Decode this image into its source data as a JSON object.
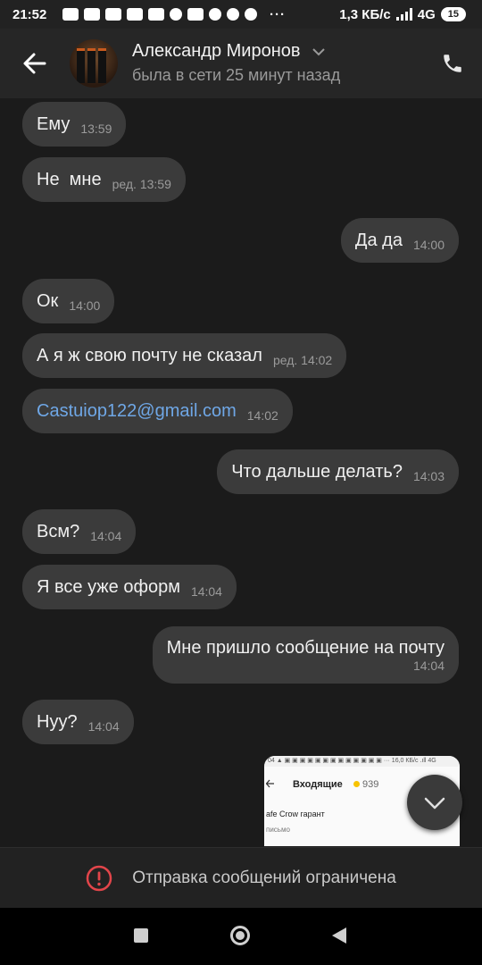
{
  "status_bar": {
    "time": "21:52",
    "dots": "···",
    "network_speed": "1,3 КБ/с",
    "network_type": "4G",
    "battery": "15"
  },
  "header": {
    "contact_name": "Александр Миронов",
    "last_seen": "была в сети 25 минут назад"
  },
  "messages": [
    {
      "side": "in",
      "text": "Ему",
      "meta": "13:59"
    },
    {
      "side": "in",
      "text": "Не  мне",
      "meta": "ред. 13:59"
    },
    {
      "side": "out",
      "text": "Да да",
      "meta": "14:00"
    },
    {
      "side": "in",
      "text": "Ок",
      "meta": "14:00"
    },
    {
      "side": "in",
      "text": "А я ж свою почту не сказал",
      "meta": "ред. 14:02"
    },
    {
      "side": "in",
      "text": "Castuiop122@gmail.com",
      "meta": "14:02",
      "is_link": true
    },
    {
      "side": "out",
      "text": "Что дальше делать?",
      "meta": "14:03"
    },
    {
      "side": "in",
      "text": "Всм?",
      "meta": "14:04"
    },
    {
      "side": "in",
      "text": "Я все уже оформ",
      "meta": "14:04"
    },
    {
      "side": "out",
      "text": "Мне пришло сообщение на почту",
      "meta": "14:04"
    },
    {
      "side": "in",
      "text": "Нуу?",
      "meta": "14:04"
    }
  ],
  "image_preview": {
    "status_text": "04 ▲ ▣ ▣ ▣ ▣ ▣ ▣ ▣ ▣ ▣ ▣ ▣ ▣ ▣ ···   16,0 КБ/с .ıll 4G",
    "title": "Входящие",
    "count": "939",
    "sender": "afe Crow гарант",
    "snippet": "письмо"
  },
  "restricted": {
    "text": "Отправка сообщений ограничена",
    "accent": "#e2454a"
  }
}
